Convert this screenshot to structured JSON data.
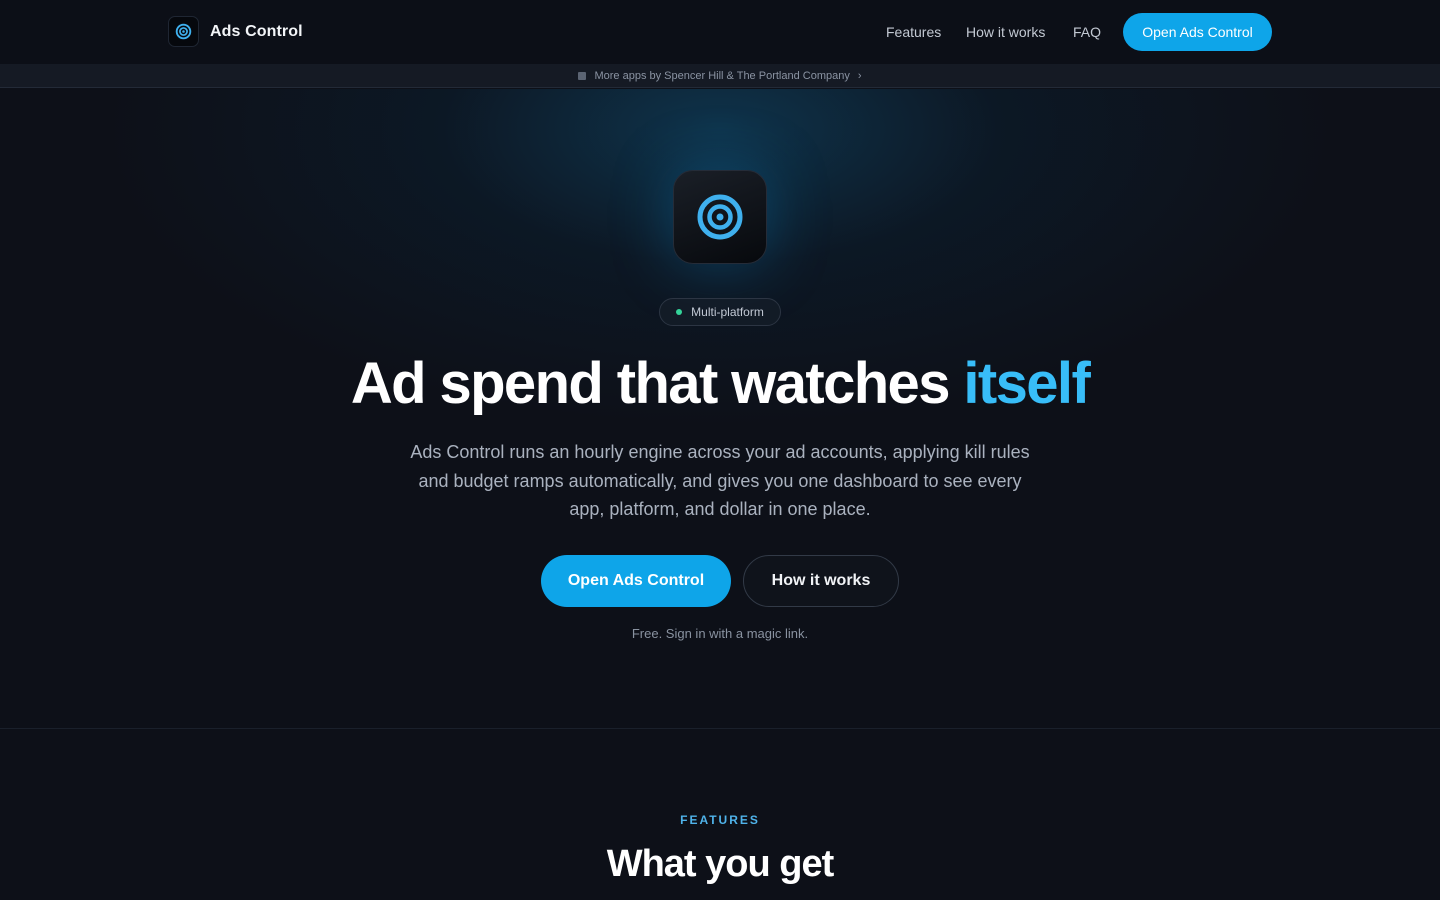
{
  "nav": {
    "brand_name": "Ads Control",
    "links": [
      {
        "label": "Features"
      },
      {
        "label": "How it works"
      },
      {
        "label": "FAQ"
      }
    ],
    "cta_label": "Open Ads Control"
  },
  "banner": {
    "text": "More apps by Spencer Hill & The Portland Company",
    "chevron": "›"
  },
  "hero": {
    "badge": "Multi-platform",
    "headline_main": "Ad spend that watches",
    "headline_accent": "itself",
    "lead": "Ads Control runs an hourly engine across your ad accounts, applying kill rules and budget ramps automatically, and gives you one dashboard to see every app, platform, and dollar in one place.",
    "primary_label": "Open Ads Control",
    "secondary_label": "How it works",
    "fineprint": "Free. Sign in with a magic link."
  },
  "features": {
    "eyebrow": "FEATURES",
    "title": "What you get"
  },
  "colors": {
    "background": "#0d1018",
    "accent": "#0ea5e9",
    "accent_text": "#38bdf8",
    "badge_dot": "#34d399"
  },
  "icons": {
    "brand": "target-icon",
    "app": "target-icon"
  }
}
